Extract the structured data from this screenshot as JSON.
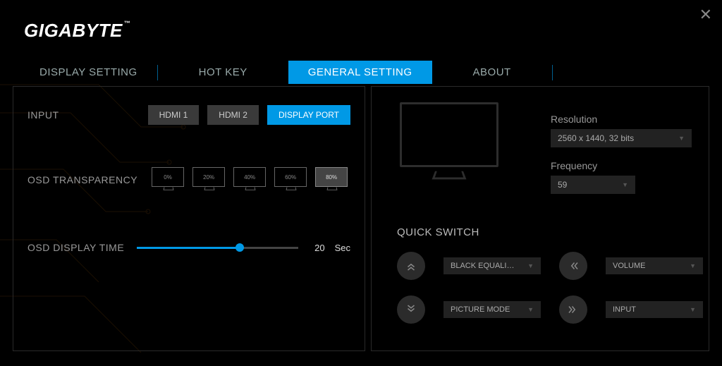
{
  "brand": "GIGABYTE",
  "tabs": {
    "display_setting": "DISPLAY SETTING",
    "hot_key": "HOT KEY",
    "general_setting": "GENERAL SETTING",
    "about": "ABOUT"
  },
  "left": {
    "input_label": "INPUT",
    "inputs": {
      "hdmi1": "HDMI 1",
      "hdmi2": "HDMI 2",
      "dp": "DISPLAY PORT"
    },
    "osd_transparency_label": "OSD TRANSPARENCY",
    "transparency_opts": [
      "0%",
      "20%",
      "40%",
      "60%",
      "80%"
    ],
    "osd_display_time_label": "OSD DISPLAY TIME",
    "osd_time_value": "20",
    "osd_time_unit": "Sec"
  },
  "right": {
    "resolution_label": "Resolution",
    "resolution_value": "2560 x 1440, 32 bits",
    "frequency_label": "Frequency",
    "frequency_value": "59",
    "quick_switch_label": "QUICK SWITCH",
    "qs": {
      "up": "BLACK EQUALI…",
      "left": "VOLUME",
      "down": "PICTURE MODE",
      "right": "INPUT"
    }
  }
}
